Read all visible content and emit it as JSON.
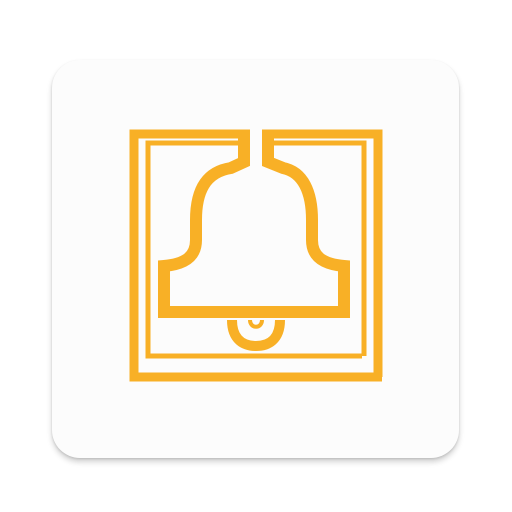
{
  "app_icon": {
    "icon": "bell-icon",
    "colors": {
      "background": "#ffffff",
      "tile": "#fcfcfc",
      "accent": "#f8b026"
    }
  }
}
